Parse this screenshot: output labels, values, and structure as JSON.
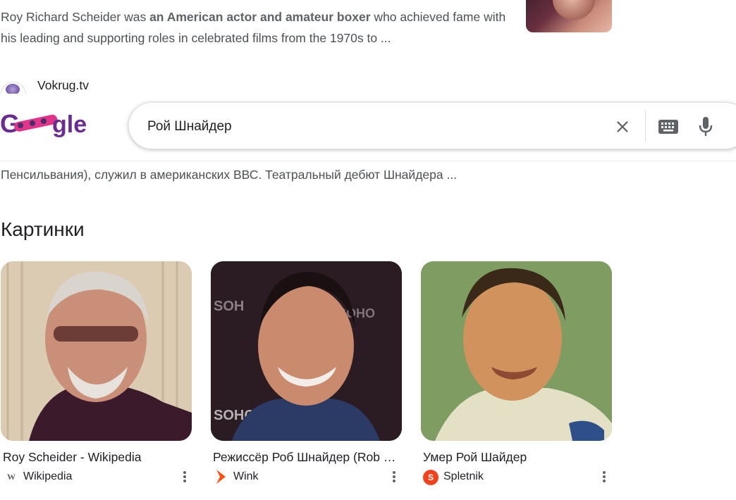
{
  "result1": {
    "snippet_pre": "Roy Richard Scheider was ",
    "snippet_bold": "an American actor and amateur boxer",
    "snippet_post": " who achieved fame with his leading and supporting roles in celebrated films from the 1970s to ..."
  },
  "result2": {
    "site_name": "Vokrug.tv",
    "snippet": "Пенсильвания), служил в американских ВВС. Театральный дебют Шнайдера ..."
  },
  "header": {
    "logo_text": "Google",
    "search_value": "Рой Шнайдер"
  },
  "images": {
    "section_title": "Картинки",
    "cards": [
      {
        "title": "Roy Scheider - Wikipedia",
        "source": "Wikipedia",
        "source_icon": "wikipedia-w",
        "source_color": "#5f6368"
      },
      {
        "title": "Режиссёр Роб Шнайдер (Rob Schneider)",
        "source": "Wink",
        "source_icon": "wink-diamond",
        "source_color": "#ff4f12"
      },
      {
        "title": "Умер Рой Шайдер",
        "source": "Spletnik",
        "source_icon": "spletnik-s",
        "source_color": "#f0421c"
      }
    ]
  },
  "icons": {
    "clear": "close-icon",
    "keyboard": "keyboard-icon",
    "mic": "mic-icon",
    "more": "more-vert-icon"
  }
}
